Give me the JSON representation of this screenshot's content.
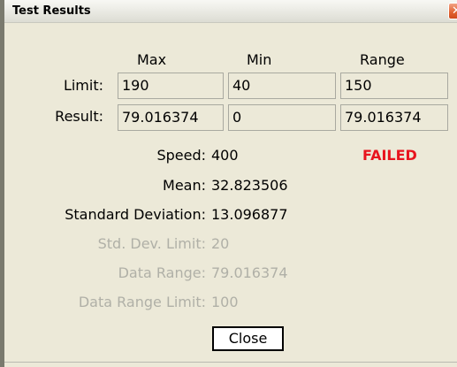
{
  "window": {
    "title": "Test Results",
    "close_glyph": "✕"
  },
  "headers": {
    "max": "Max",
    "min": "Min",
    "range": "Range"
  },
  "rows": {
    "limit": {
      "label": "Limit:",
      "max": "190",
      "min": "40",
      "range": "150"
    },
    "result": {
      "label": "Result:",
      "max": "79.016374",
      "min": "0",
      "range": "79.016374"
    }
  },
  "stats": {
    "speed": {
      "label": "Speed:",
      "value": "400"
    },
    "status": "FAILED",
    "mean": {
      "label": "Mean:",
      "value": "32.823506"
    },
    "std_dev": {
      "label": "Standard Deviation:",
      "value": "13.096877"
    },
    "std_dev_limit": {
      "label": "Std. Dev. Limit:",
      "value": "20"
    },
    "data_range": {
      "label": "Data Range:",
      "value": "79.016374"
    },
    "data_range_limit": {
      "label": "Data Range Limit:",
      "value": "100"
    }
  },
  "buttons": {
    "close": "Close"
  },
  "colors": {
    "failed": "#e8141e",
    "disabled_text": "#b0b0a7",
    "window_bg": "#ece9d8"
  }
}
